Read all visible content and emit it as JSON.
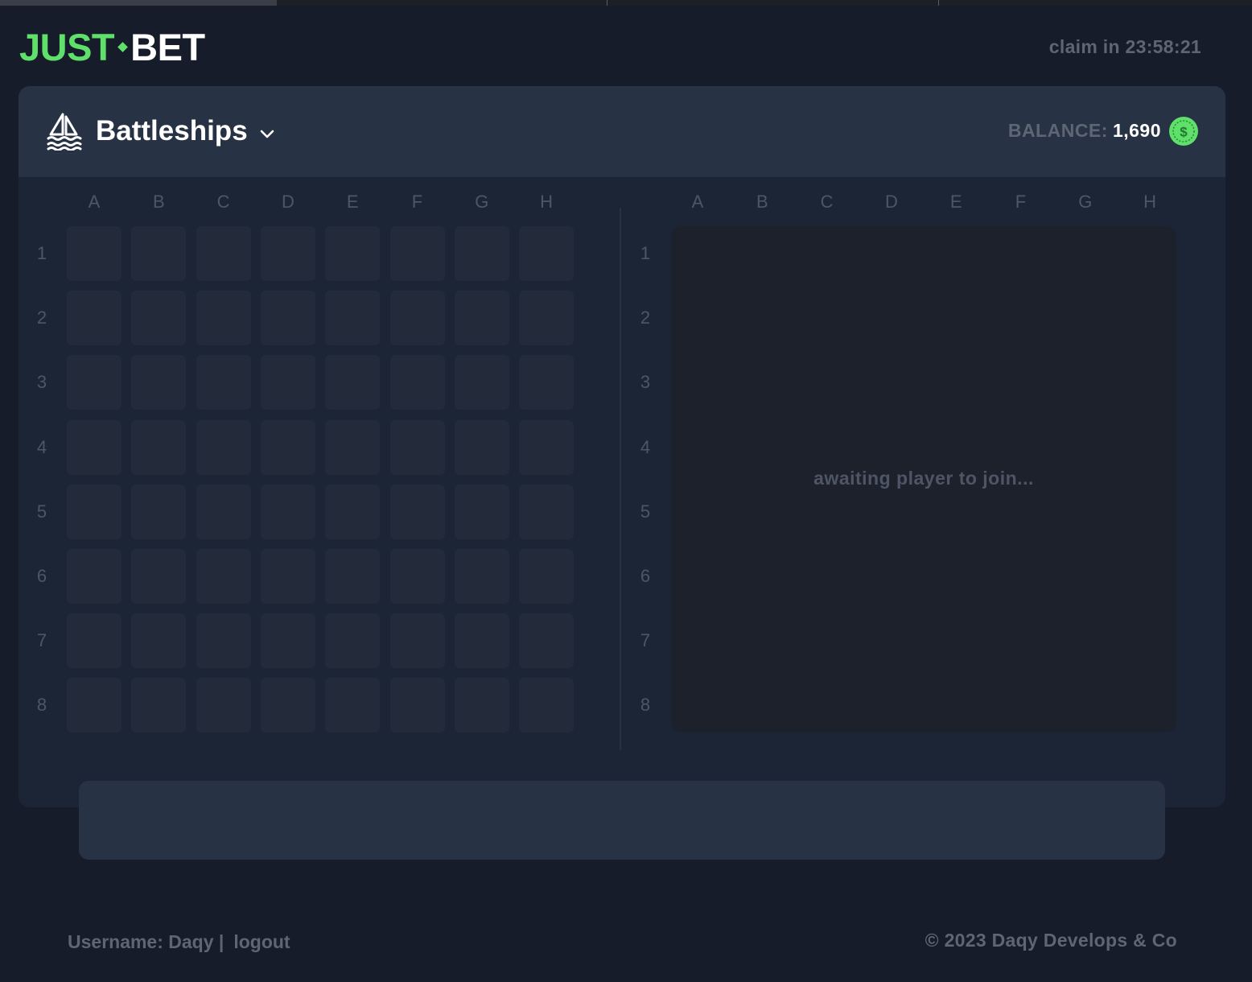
{
  "brand": {
    "left": "JUST",
    "right": "BET"
  },
  "header": {
    "claim_text": "claim in 23:58:21"
  },
  "game": {
    "title": "Battleships",
    "balance_label": "BALANCE:",
    "balance_value": "1,690",
    "coin_symbol": "$"
  },
  "board": {
    "columns": [
      "A",
      "B",
      "C",
      "D",
      "E",
      "F",
      "G",
      "H"
    ],
    "rows": [
      "1",
      "2",
      "3",
      "4",
      "5",
      "6",
      "7",
      "8"
    ]
  },
  "opponent": {
    "status": "awaiting player to join..."
  },
  "footer": {
    "username": "Username: Daqy |",
    "logout": "logout",
    "copyright": "© 2023 Daqy Develops & Co"
  },
  "colors": {
    "accent": "#5fe06a",
    "background": "#161c29",
    "card": "#1c2536",
    "card_header": "#283245",
    "cell": "#232b3a"
  }
}
